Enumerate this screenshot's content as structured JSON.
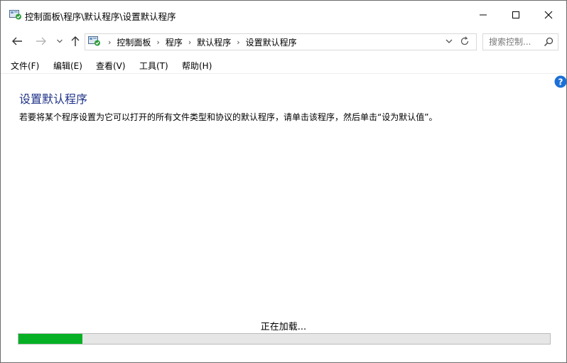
{
  "window": {
    "title": "控制面板\\程序\\默认程序\\设置默认程序",
    "icon": "control-panel-icon",
    "controls": {
      "minimize": "minimize-icon",
      "maximize": "maximize-icon",
      "close": "close-icon"
    }
  },
  "nav": {
    "back_icon": "back-arrow-icon",
    "forward_icon": "forward-arrow-icon",
    "recent_icon": "chevron-down-icon",
    "up_icon": "up-arrow-icon",
    "breadcrumb": [
      "控制面板",
      "程序",
      "默认程序",
      "设置默认程序"
    ],
    "search_placeholder": "搜索控制..."
  },
  "menu": [
    "文件(F)",
    "编辑(E)",
    "查看(V)",
    "工具(T)",
    "帮助(H)"
  ],
  "content": {
    "title": "设置默认程序",
    "description": "若要将某个程序设置为它可以打开的所有文件类型和协议的默认程序，请单击该程序，然后单击“设为默认值”。",
    "loading_text": "正在加载...",
    "progress": 0.12
  },
  "colors": {
    "title": "#1e3287",
    "progress_fill": "#06b025",
    "progress_track": "#e6e6e6",
    "help": "#1c6fd6"
  }
}
